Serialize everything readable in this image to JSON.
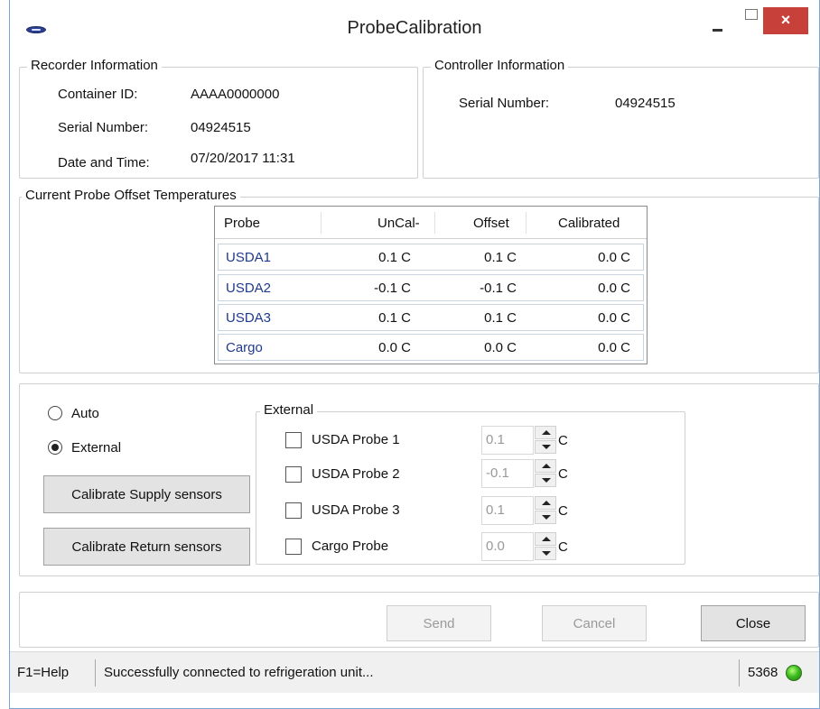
{
  "window": {
    "title": "ProbeCalibration",
    "close_glyph": "×"
  },
  "recorder": {
    "legend": "Recorder Information",
    "fields": [
      {
        "label": "Container ID:",
        "value": "AAAA0000000"
      },
      {
        "label": "Serial Number:",
        "value": "04924515"
      },
      {
        "label": "Date and Time:",
        "value": "07/20/2017 11:31"
      }
    ]
  },
  "controller": {
    "legend": "Controller Information",
    "serial_label": "Serial Number:",
    "serial_value": "04924515"
  },
  "offsets": {
    "legend": "Current Probe Offset Temperatures",
    "columns": [
      "Probe",
      "UnCal-",
      "Offset",
      "Calibrated"
    ],
    "rows": [
      {
        "probe": "USDA1",
        "uncal": "0.1 C",
        "offset": "0.1 C",
        "calibrated": "0.0 C"
      },
      {
        "probe": "USDA2",
        "uncal": "-0.1 C",
        "offset": "-0.1 C",
        "calibrated": "0.0 C"
      },
      {
        "probe": "USDA3",
        "uncal": "0.1 C",
        "offset": "0.1 C",
        "calibrated": "0.0 C"
      },
      {
        "probe": "Cargo",
        "uncal": "0.0 C",
        "offset": "0.0 C",
        "calibrated": "0.0 C"
      }
    ]
  },
  "mode": {
    "options": [
      {
        "label": "Auto",
        "selected": false
      },
      {
        "label": "External",
        "selected": true
      }
    ],
    "calibrate_supply_label": "Calibrate Supply sensors",
    "calibrate_return_label": "Calibrate Return sensors"
  },
  "external": {
    "legend": "External",
    "unit": "C",
    "probes": [
      {
        "label": "USDA Probe 1",
        "value": "0.1",
        "checked": false
      },
      {
        "label": "USDA Probe 2",
        "value": "-0.1",
        "checked": false
      },
      {
        "label": "USDA Probe 3",
        "value": "0.1",
        "checked": false
      },
      {
        "label": "Cargo Probe",
        "value": "0.0",
        "checked": false
      }
    ]
  },
  "actions": {
    "send": "Send",
    "cancel": "Cancel",
    "close": "Close"
  },
  "status": {
    "help": "F1=Help",
    "message": "Successfully connected to refrigeration unit...",
    "code": "5368",
    "indicator_color": "#3fbe21"
  }
}
